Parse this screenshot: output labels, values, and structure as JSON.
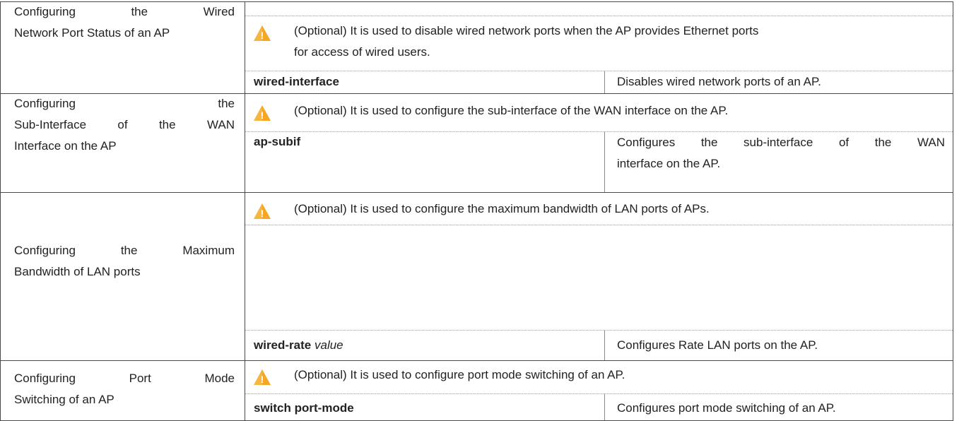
{
  "rows": [
    {
      "feature": [
        "Configuring the Wired",
        "Network Port Status of an AP"
      ],
      "note": [
        "(Optional) It is used to disable wired network ports when the AP provides Ethernet ports",
        "for access of wired users."
      ],
      "command": "wired-interface",
      "command_arg": "",
      "description": [
        "Disables wired network ports of an AP."
      ]
    },
    {
      "feature": [
        "Configuring the",
        "Sub-Interface of the WAN",
        "Interface on the AP"
      ],
      "note": [
        "(Optional) It is used to configure the sub-interface of the WAN interface on the AP."
      ],
      "command": "ap-subif",
      "command_arg": "",
      "description": [
        "Configures the sub-interface of the WAN",
        "interface on the AP."
      ]
    },
    {
      "feature": [
        "Configuring the Maximum",
        "Bandwidth of LAN ports"
      ],
      "note": [
        "(Optional) It is used to configure the maximum bandwidth of LAN ports of APs."
      ],
      "command": "wired-rate",
      "command_arg": "value",
      "description": [
        "Configures Rate LAN ports on the AP."
      ]
    },
    {
      "feature": [
        "Configuring Port Mode",
        "Switching of an AP"
      ],
      "note": [
        "(Optional) It is used to configure port mode switching of an AP."
      ],
      "command": "switch port-mode",
      "command_arg": "",
      "description": [
        "Configures port mode switching of an AP."
      ]
    }
  ],
  "icons": {
    "warning": "warning-triangle-icon",
    "warning_color": "#f5a623",
    "warning_mark": "!"
  }
}
